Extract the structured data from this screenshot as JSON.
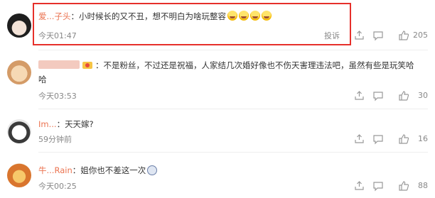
{
  "comments": [
    {
      "username": "爱...子头",
      "text": "小时候长的又不丑，想不明白为啥玩整容",
      "time": "今天01:47",
      "report_label": "投诉",
      "likes": "205",
      "emoji": [
        "laugh-cry-emoji",
        "laugh-cry-emoji",
        "laugh-cry-emoji",
        "laugh-cry-emoji"
      ]
    },
    {
      "username": "",
      "text": "不是粉丝，不过还是祝福，人家结几次婚好像也不伤天害理违法吧，虽然有些是玩笑哈",
      "text_wrap": "哈",
      "time": "今天03:53",
      "likes": "30"
    },
    {
      "username": "Im...",
      "text": "天天嫁?",
      "time": "59分钟前",
      "likes": "16"
    },
    {
      "username": "牛...Rain",
      "text": "姐你也不差这一次",
      "time": "今天00:25",
      "likes": "88"
    }
  ],
  "colors": {
    "username": "#eb7350",
    "highlight_border": "#e6302b",
    "timestamp": "#888888",
    "body_text": "#333333"
  },
  "icons": {
    "share": "share-icon",
    "reply": "comment-icon",
    "like": "thumbs-up-icon"
  }
}
